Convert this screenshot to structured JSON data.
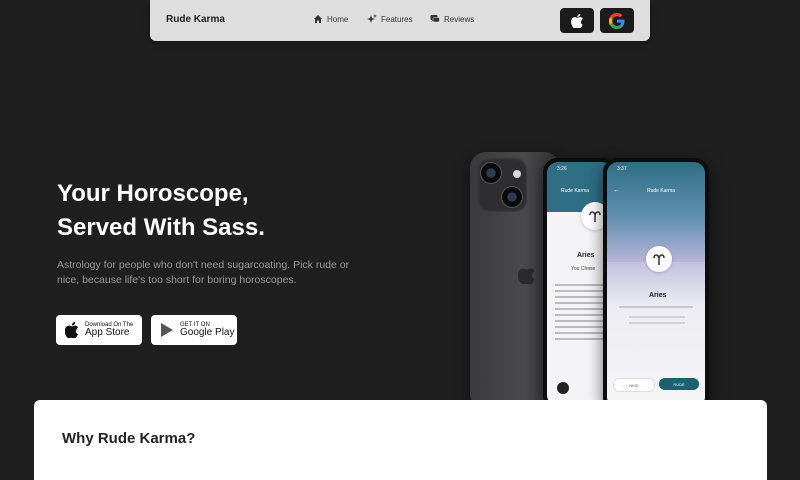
{
  "navbar": {
    "brand": "Rude Karma",
    "links": [
      {
        "label": "Home",
        "icon": "home-icon"
      },
      {
        "label": "Features",
        "icon": "sparkles-icon"
      },
      {
        "label": "Reviews",
        "icon": "chat-icon"
      }
    ],
    "store_icons": [
      "apple-icon",
      "google-icon"
    ]
  },
  "hero": {
    "title_line1": "Your Horoscope,",
    "title_line2": "Served With Sass.",
    "subtitle": "Astrology for people who don't need sugarcoating. Pick rude or nice, because life's too short for boring horoscopes.",
    "app_store": {
      "small": "Download On The",
      "big": "App Store"
    },
    "google_play": {
      "small": "GET IT ON",
      "big": "Google Play"
    }
  },
  "phone_screens": {
    "front": {
      "time": "3:37",
      "app_title": "Rude Karma",
      "sign": "Aries",
      "btn_left": "NICE",
      "btn_right": "RUDE"
    },
    "back": {
      "time": "3:26",
      "app_title": "Rude Karma",
      "sign": "Aries",
      "heading": "You Chose"
    }
  },
  "section": {
    "title": "Why Rude Karma?"
  },
  "colors": {
    "background": "#1f1f20",
    "navbar": "#dedede",
    "teal": "#2f6e84",
    "rude_button": "#1e5f72"
  }
}
